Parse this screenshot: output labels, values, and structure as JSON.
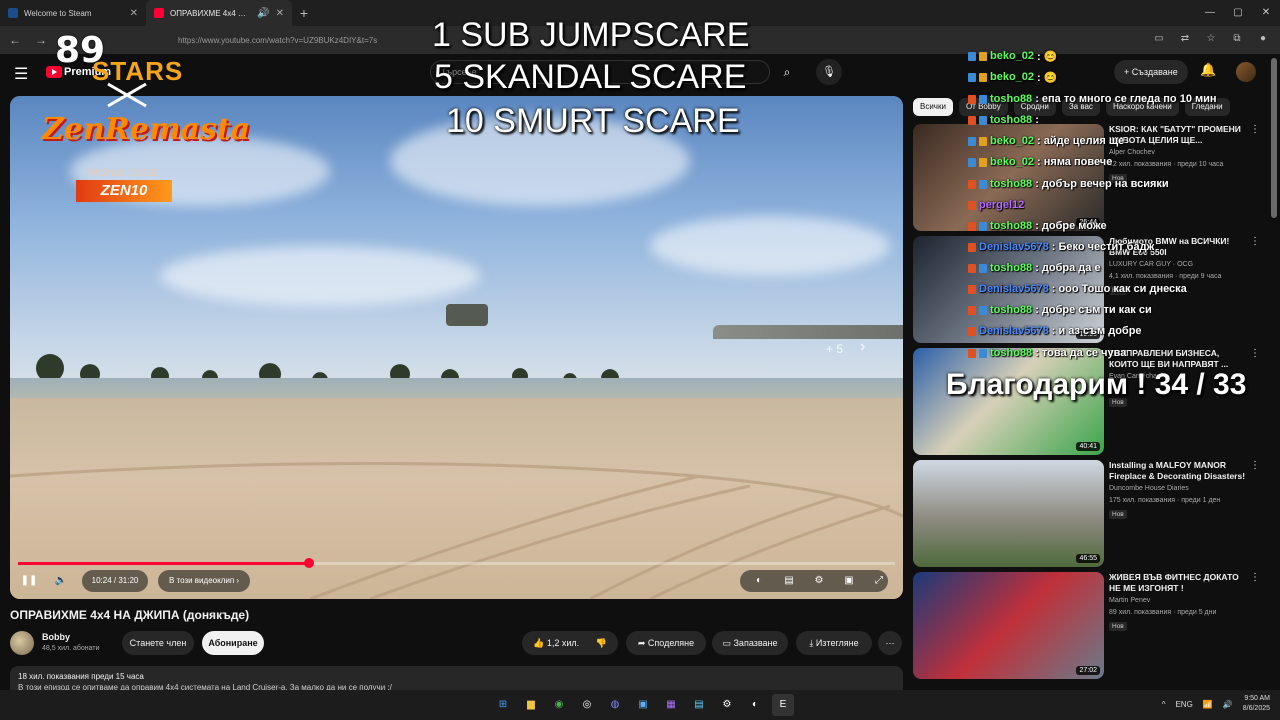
{
  "browser": {
    "tabs": [
      {
        "title": "Welcome to Steam",
        "active": false
      },
      {
        "title": "ОПРАВИХМЕ 4x4 НА ДЖИП",
        "active": true
      }
    ],
    "url": "https://www.youtube.com/watch?v=UZ9BUKz4DIY&t=7s"
  },
  "youtube": {
    "logo_text": "Premium",
    "search_placeholder": "Търсене",
    "create_label": "Създаване"
  },
  "player": {
    "time": "10:24 / 31:20",
    "progress": 0.332,
    "chapter": "В този видеоклип",
    "skip_label": "+ 5"
  },
  "overlay": {
    "brand_number": "89",
    "brand_word": "STARS",
    "sponsor_name": "ZenRemasta",
    "promo_label": "PROMO CODE",
    "promo_code": "ZEN10",
    "goals": [
      "1 SUB JUMPSCARE",
      "5 SKANDAL SCARE",
      "10 SMURT SCARE"
    ],
    "thanks": "Благодарим ! 34 / 33"
  },
  "video": {
    "title": "ОПРАВИХМЕ 4x4 НА ДЖИПА (донякъде)",
    "channel": "Bobby",
    "subscribers": "48,5 хил. абонати",
    "join_label": "Станете член",
    "subscribe_label": "Абониране",
    "likes": "1,2 хил.",
    "share_label": "Споделяне",
    "save_label": "Запазване",
    "download_label": "Изтегляне",
    "views_line": "18 хил. показвания  преди 15 часа",
    "desc_line": "В този епизод се опитваме да оправим 4x4 системата на Land Cruiser-а. За малко да ни се получи :/"
  },
  "filters": [
    "Всички",
    "От Bobby",
    "Сродни",
    "За вас",
    "Наскоро качени",
    "Гледани"
  ],
  "recommendations": [
    {
      "title": "KSIOR: КАК \"БАТУТ\" ПРОМЕНИ ЖИВОТА ЦЕЛИЯ ЩЕ...",
      "channel": "Alper Chochev",
      "meta": "12 хил. показвания · преди 10 часа",
      "badge": "Нов",
      "duration": "26:44"
    },
    {
      "title": "Любимото BMW на ВСИЧКИ! BMW E60 550I",
      "channel": "LUXURY CAR GUY · OCG",
      "meta": "4,1 хил. показвания · преди 9 часа",
      "badge": "Нов",
      "duration": "19:55"
    },
    {
      "title": "10 УПРАВЛЕНИ БИЗНЕСА, КОИТО ЩЕ ВИ НАПРАВЯТ ...",
      "channel": "Evan Carmichael",
      "meta": "",
      "badge": "Нов",
      "duration": "40:41"
    },
    {
      "title": "Installing a MALFOY MANOR Fireplace & Decorating Disasters!",
      "channel": "Duncombe House Diaries",
      "meta": "175 хил. показвания · преди 1 ден",
      "badge": "Нов",
      "duration": "46:55"
    },
    {
      "title": "ЖИВЕЯ ВЪВ ФИТНЕС ДОКАТО НЕ МЕ ИЗГОНЯТ !",
      "channel": "Martin Penev",
      "meta": "89 хил. показвания · преди 5 дни",
      "badge": "Нов",
      "duration": "27:02"
    }
  ],
  "chat": [
    {
      "name": "beko_02",
      "msg": ": 😊"
    },
    {
      "name": "beko_02",
      "msg": ": 😊"
    },
    {
      "name": "tosho88",
      "msg": ": епа то много се гледа по 10 мин"
    },
    {
      "name": "tosho88",
      "msg": ":"
    },
    {
      "name": "beko_02",
      "msg": ": айде целия ще"
    },
    {
      "name": "beko_02",
      "msg": ": няма повече"
    },
    {
      "name": "tosho88",
      "msg": ": добър вечер на всияки"
    },
    {
      "name": "pergel12",
      "msg": ""
    },
    {
      "name": "tosho88",
      "msg": ": добре може"
    },
    {
      "name": "Denislav5678",
      "msg": ": Беко честит бадж"
    },
    {
      "name": "tosho88",
      "msg": ": добра да е"
    },
    {
      "name": "Denislav5678",
      "msg": ": ооо Тошо как си днеска"
    },
    {
      "name": "tosho88",
      "msg": ": добре съм ти как си"
    },
    {
      "name": "Denislav5678",
      "msg": ": и аз съм добре"
    },
    {
      "name": "tosho88",
      "msg": ": това да се чува"
    }
  ],
  "taskbar": {
    "lang": "ENG",
    "time": "9:50 AM",
    "date": "8/6/2025"
  },
  "colors": {
    "accent": "#ff0033",
    "chat_name": "#5aff5a",
    "background": "#0f0f0f"
  }
}
